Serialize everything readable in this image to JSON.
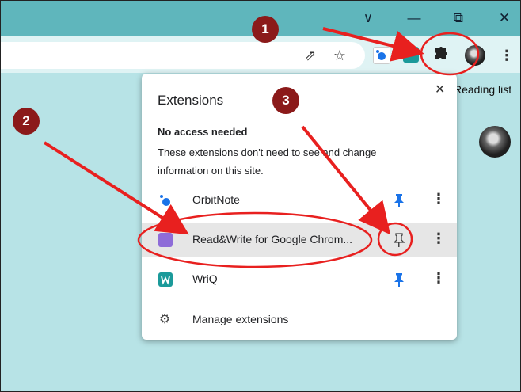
{
  "window": {
    "dropdown_glyph": "∨",
    "minimize_glyph": "—",
    "restore_glyph": "⧉",
    "close_glyph": "✕"
  },
  "toolbar": {
    "share_glyph": "⇗",
    "star_glyph": "☆",
    "menu_glyph": "⋮",
    "extensions_glyph": "✦"
  },
  "bookmarks": {
    "reading_list": "Reading list"
  },
  "popup": {
    "title": "Extensions",
    "close_glyph": "✕",
    "section_heading": "No access needed",
    "section_desc": "These extensions don't need to see and change information on this site.",
    "extensions": [
      {
        "name": "OrbitNote",
        "pinned": true,
        "icon": "orbitnote-icon",
        "color": "#1a73e8"
      },
      {
        "name": "Read&Write for Google Chrom...",
        "pinned": false,
        "icon": "readwrite-icon",
        "color": "#8e6cd8"
      },
      {
        "name": "WriQ",
        "pinned": true,
        "icon": "wriq-icon",
        "color": "#1b9a9a"
      }
    ],
    "more_glyph": "⋮",
    "pin_glyph": "📌",
    "manage": "Manage extensions",
    "gear_glyph": "⚙"
  },
  "annotations": {
    "badges": [
      "1",
      "2",
      "3"
    ],
    "arrow_color": "#e8201f",
    "badge_color": "#8b1a1a"
  }
}
